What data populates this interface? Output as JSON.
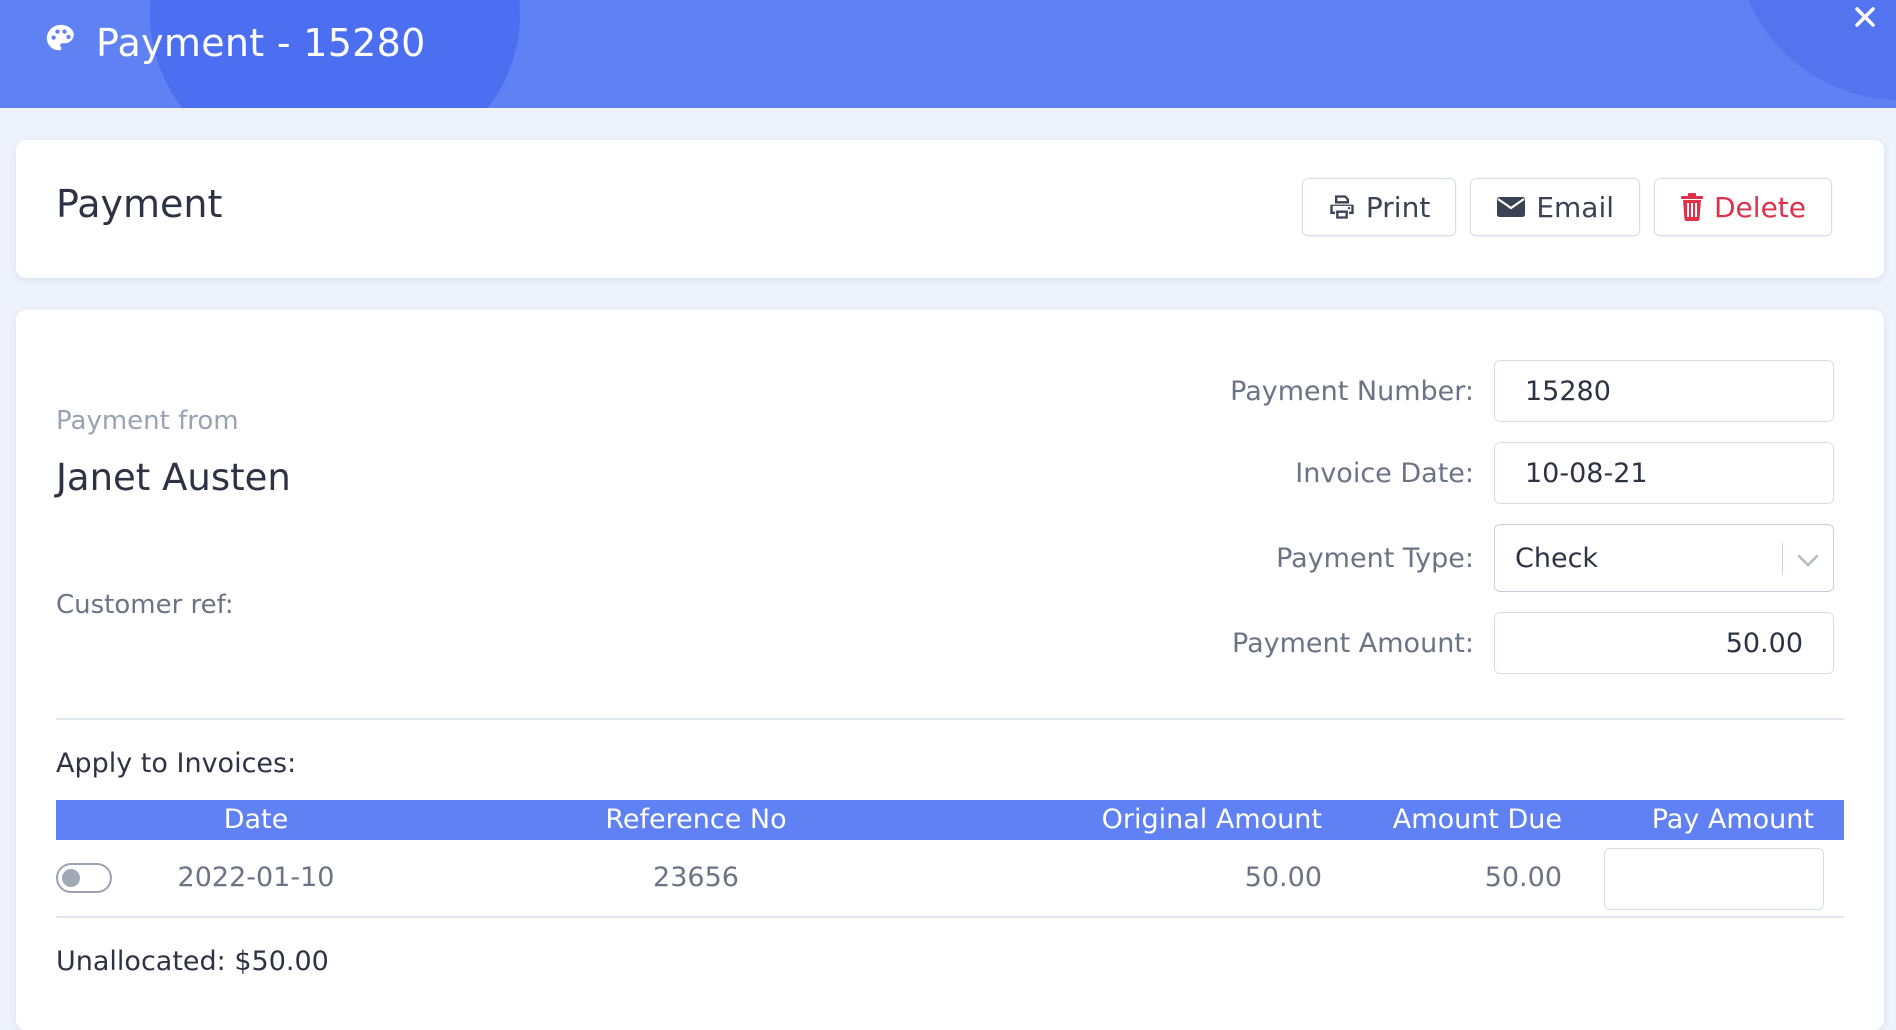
{
  "window": {
    "title": "Payment - 15280",
    "icon": "palette-icon",
    "close_icon": "close-icon"
  },
  "colors": {
    "header": "#5f81f3",
    "accent": "#5f81f3",
    "danger": "#e0314b",
    "background": "#eef2fa"
  },
  "toolbar": {
    "page_title": "Payment",
    "print_label": "Print",
    "email_label": "Email",
    "delete_label": "Delete"
  },
  "customer": {
    "from_label": "Payment from",
    "name": "Janet Austen",
    "ref_label": "Customer ref:"
  },
  "form": {
    "payment_number_label": "Payment Number:",
    "payment_number": "15280",
    "invoice_date_label": "Invoice Date:",
    "invoice_date": "10-08-21",
    "payment_type_label": "Payment Type:",
    "payment_type": "Check",
    "payment_amount_label": "Payment Amount:",
    "payment_amount": "50.00"
  },
  "invoices": {
    "section_label": "Apply to Invoices:",
    "columns": {
      "date": "Date",
      "reference": "Reference No",
      "original": "Original Amount",
      "due": "Amount Due",
      "pay": "Pay Amount"
    },
    "rows": [
      {
        "selected": false,
        "date": "2022-01-10",
        "reference": "23656",
        "original": "50.00",
        "due": "50.00",
        "pay": ""
      }
    ]
  },
  "summary": {
    "unallocated": "Unallocated: $50.00"
  }
}
